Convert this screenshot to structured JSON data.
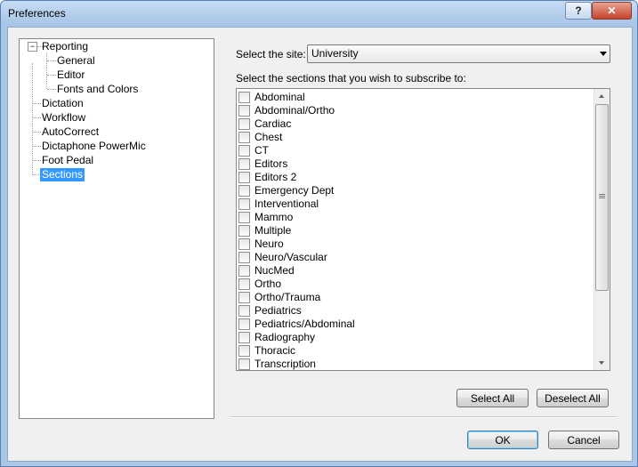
{
  "window": {
    "title": "Preferences",
    "help_glyph": "?",
    "close_glyph": "✕"
  },
  "tree": {
    "expander_glyph": "−",
    "items": [
      {
        "label": "Reporting"
      },
      {
        "label": "General"
      },
      {
        "label": "Editor"
      },
      {
        "label": "Fonts and Colors"
      },
      {
        "label": "Dictation"
      },
      {
        "label": "Workflow"
      },
      {
        "label": "AutoCorrect"
      },
      {
        "label": "Dictaphone PowerMic"
      },
      {
        "label": "Foot Pedal"
      },
      {
        "label": "Sections"
      }
    ],
    "selected": "Sections"
  },
  "site": {
    "label": "Select the site:",
    "value": "University"
  },
  "sections": {
    "label": "Select the sections that you wish to subscribe to:",
    "items": [
      "Abdominal",
      "Abdominal/Ortho",
      "Cardiac",
      "Chest",
      "CT",
      "Editors",
      "Editors 2",
      "Emergency Dept",
      "Interventional",
      "Mammo",
      "Multiple",
      "Neuro",
      "Neuro/Vascular",
      "NucMed",
      "Ortho",
      "Ortho/Trauma",
      "Pediatrics",
      "Pediatrics/Abdominal",
      "Radiography",
      "Thoracic",
      "Transcription"
    ]
  },
  "buttons": {
    "select_all": "Select All",
    "deselect_all": "Deselect All",
    "ok": "OK",
    "cancel": "Cancel"
  }
}
